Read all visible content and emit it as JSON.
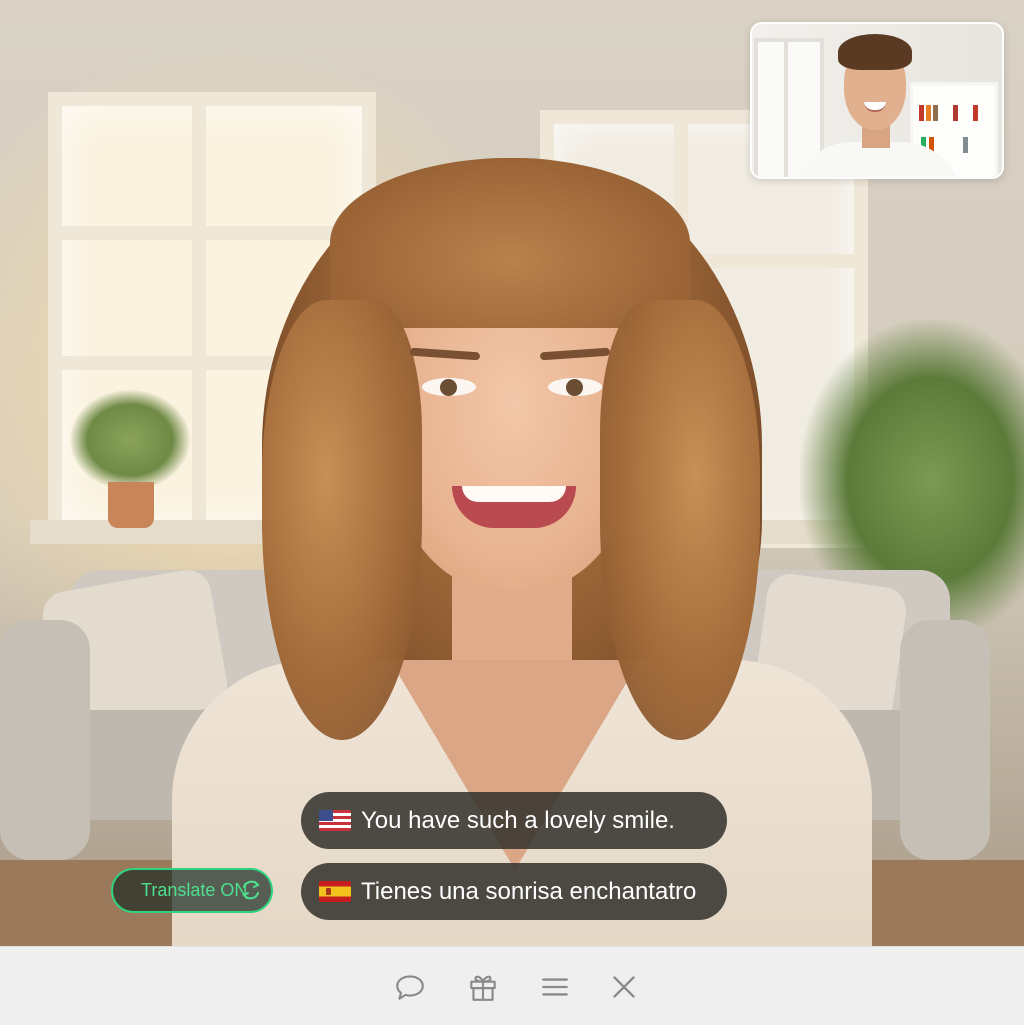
{
  "video_call": {
    "remote_video_label": "remote participant video",
    "self_view_label": "self view"
  },
  "captions": {
    "original": {
      "flag_icon": "us-flag-icon",
      "text": "You have such a lovely smile."
    },
    "translated": {
      "flag_icon": "spain-flag-icon",
      "text": "Tienes una sonrisa enchantatro"
    }
  },
  "translate_toggle": {
    "label": "Translate ON",
    "icon": "translate-swap-icon",
    "state_color": "#2fd37f"
  },
  "toolbar": {
    "buttons": [
      {
        "icon": "chat-bubble-icon",
        "action": "chat"
      },
      {
        "icon": "gift-icon",
        "action": "gift"
      },
      {
        "icon": "menu-icon",
        "action": "menu"
      },
      {
        "icon": "close-icon",
        "action": "end"
      }
    ],
    "icon_color": "#8a8a8a",
    "background": "#efefef"
  }
}
